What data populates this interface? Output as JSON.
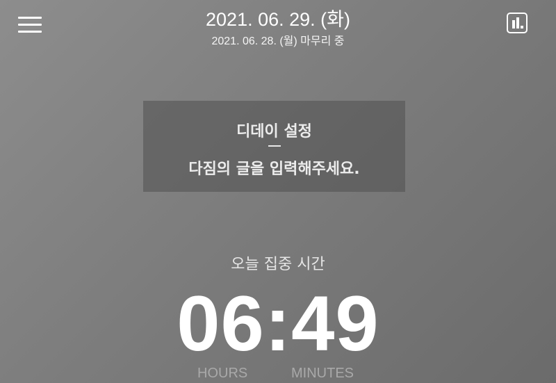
{
  "header": {
    "menu_icon": "hamburger-menu-icon",
    "stats_icon": "bar-chart-icon",
    "date_main": "2021. 06. 29. (화)",
    "date_sub": "2021. 06. 28. (월) 마무리 중"
  },
  "dday": {
    "title": "디데이 설정",
    "divider": "—",
    "message": "다짐의 글을 입력해주세요."
  },
  "focus": {
    "label": "오늘 집중 시간",
    "time": "06:49",
    "hours_label": "HOURS",
    "minutes_label": "MINUTES"
  },
  "colors": {
    "background_start": "#8d8d8d",
    "background_end": "#6b6b6b",
    "text": "#ffffff",
    "unit_label": "#a9a9a9"
  }
}
